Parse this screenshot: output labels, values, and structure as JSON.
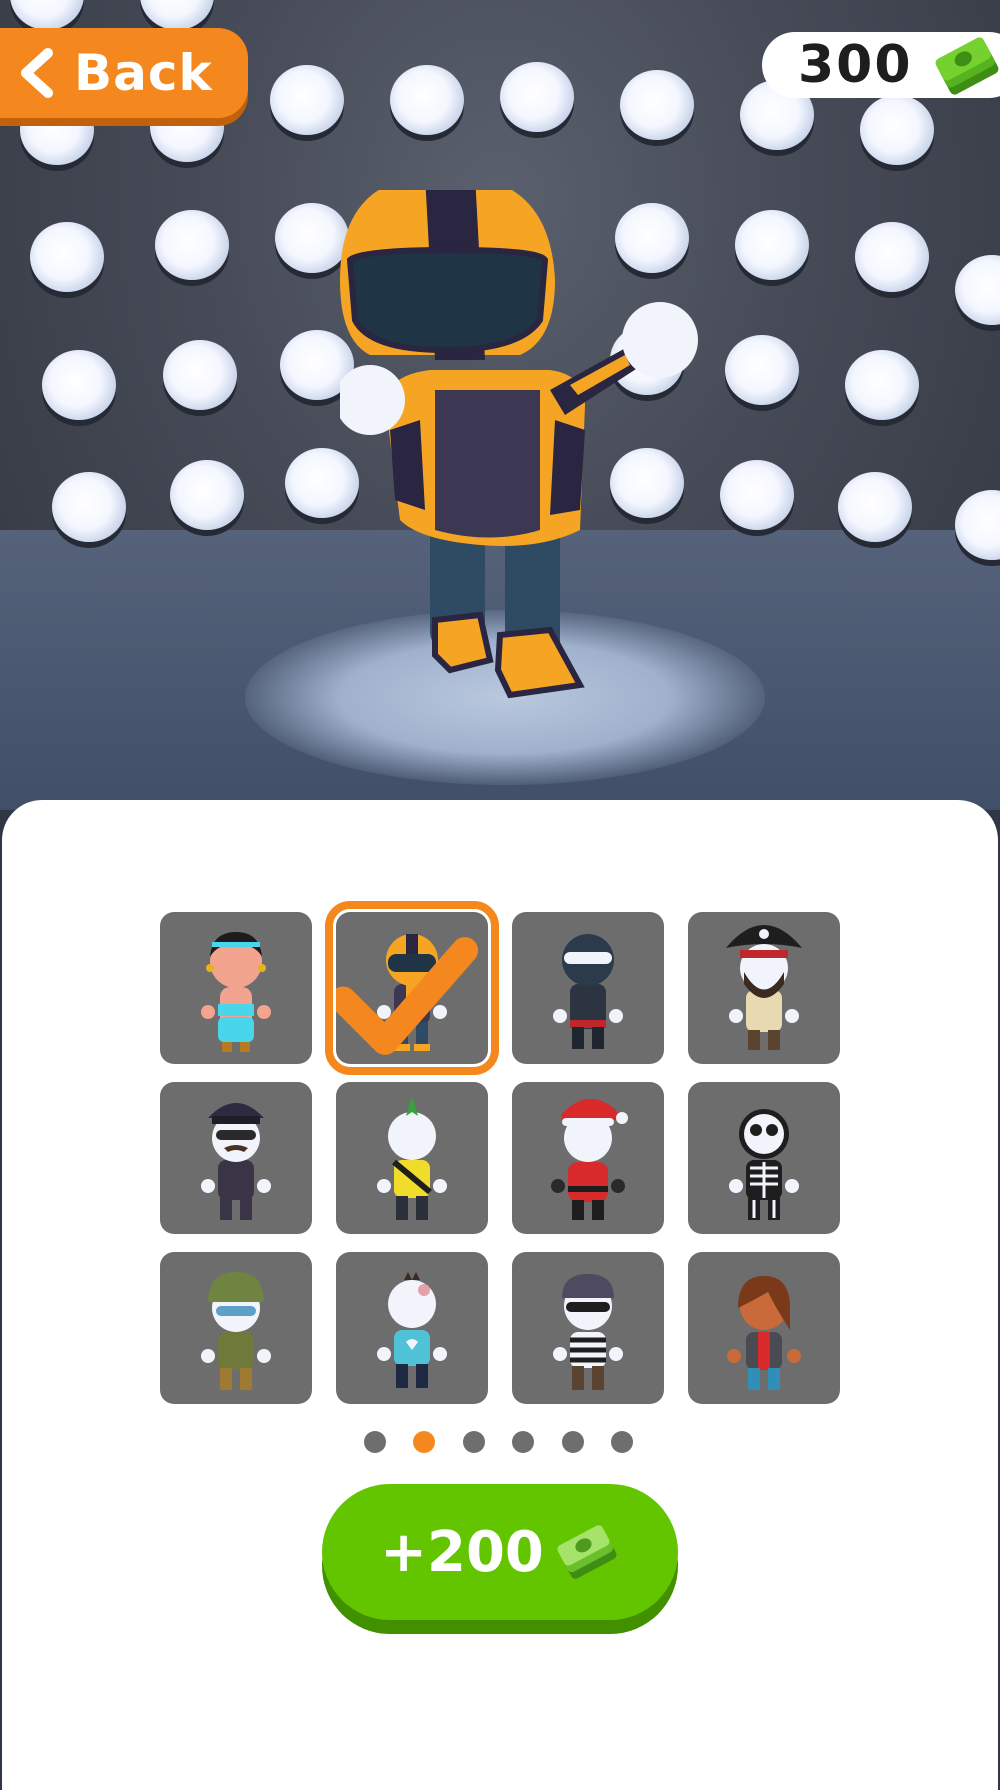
{
  "header": {
    "back_label": "Back",
    "currency_amount": "300",
    "currency_icon": "cash-stack-icon"
  },
  "hero": {
    "character": "helmet-racer"
  },
  "skins": [
    {
      "id": "genie-girl",
      "selected": false
    },
    {
      "id": "helmet-racer",
      "selected": true
    },
    {
      "id": "ninja",
      "selected": false
    },
    {
      "id": "pirate",
      "selected": false
    },
    {
      "id": "police-officer",
      "selected": false
    },
    {
      "id": "mohawk-punk",
      "selected": false
    },
    {
      "id": "santa",
      "selected": false
    },
    {
      "id": "skeleton",
      "selected": false
    },
    {
      "id": "soldier",
      "selected": false
    },
    {
      "id": "zombie-heart-shirt",
      "selected": false
    },
    {
      "id": "robber",
      "selected": false
    },
    {
      "id": "red-haired-girl",
      "selected": false
    }
  ],
  "pagination": {
    "pages": 6,
    "current": 2
  },
  "reward_button": {
    "label": "+200",
    "icon": "cash-stack-icon"
  },
  "colors": {
    "accent_orange": "#f5871f",
    "reward_green": "#62c500",
    "card_gray": "#6d6d6d"
  }
}
